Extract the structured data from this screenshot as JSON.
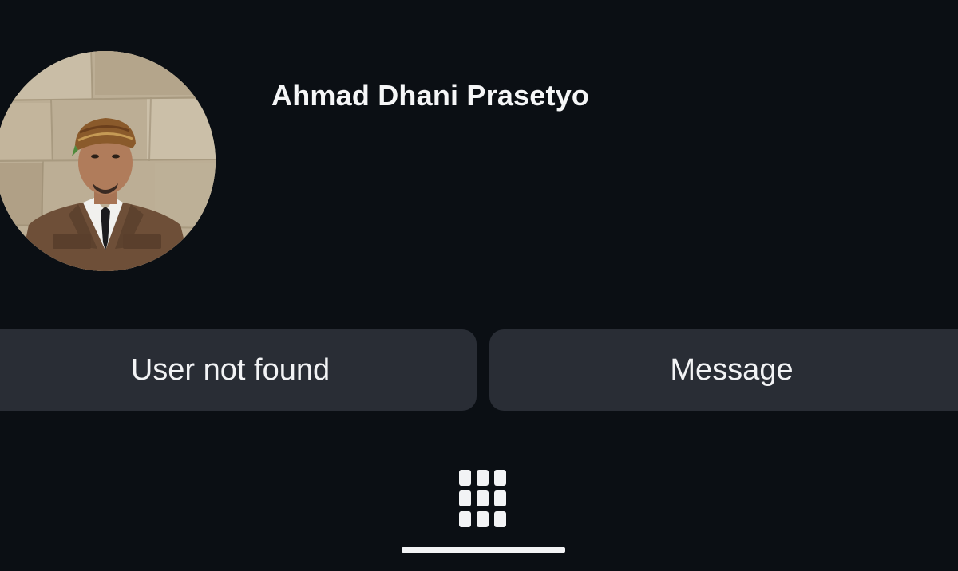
{
  "profile": {
    "name": "Ahmad Dhani Prasetyo",
    "avatar_alt": "profile photo"
  },
  "actions": {
    "primary_label": "User not found",
    "secondary_label": "Message"
  },
  "tabs": {
    "active_icon": "grid-icon",
    "active": "posts-grid"
  },
  "colors": {
    "background": "#0b0f14",
    "button_bg": "#292d35",
    "text": "#f2f3f5"
  }
}
